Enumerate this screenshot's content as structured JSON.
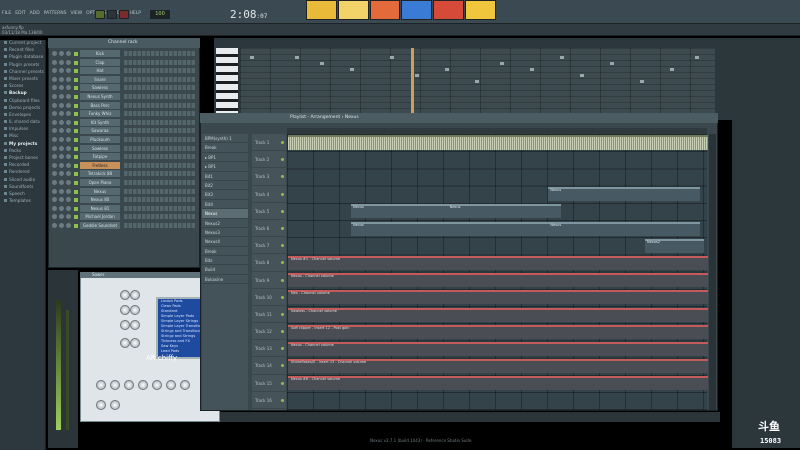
{
  "app": {
    "menu": [
      "FILE",
      "EDIT",
      "ADD",
      "PATTERNS",
      "VIEW",
      "OPTIONS",
      "TOOLS",
      "HELP"
    ],
    "time": "2:08",
    "time_suffix": ":07",
    "tempo": "100",
    "hint": "asfunny.flp",
    "hint2": "03/11/18 Ma 138/00",
    "thumb_colors": [
      "#e9b93a",
      "#f1d36a",
      "#e26a3b",
      "#3a7bd5",
      "#d64a3a",
      "#f0c63c"
    ]
  },
  "browser": {
    "items": [
      {
        "label": "Current project",
        "hl": false
      },
      {
        "label": "Recent files",
        "hl": false
      },
      {
        "label": "Plugin database",
        "hl": false
      },
      {
        "label": "Plugin presets",
        "hl": false
      },
      {
        "label": "Channel presets",
        "hl": false
      },
      {
        "label": "Mixer presets",
        "hl": false
      },
      {
        "label": "Scores",
        "hl": false
      },
      {
        "label": "Backup",
        "hl": true
      },
      {
        "label": "Clipboard files",
        "hl": false
      },
      {
        "label": "Demo projects",
        "hl": false
      },
      {
        "label": "Envelopes",
        "hl": false
      },
      {
        "label": "IL shared data",
        "hl": false
      },
      {
        "label": "Impulses",
        "hl": false
      },
      {
        "label": "Misc",
        "hl": false
      },
      {
        "label": "My projects",
        "hl": true
      },
      {
        "label": "Packs",
        "hl": false
      },
      {
        "label": "Project bones",
        "hl": false
      },
      {
        "label": "Recorded",
        "hl": false
      },
      {
        "label": "Rendered",
        "hl": false
      },
      {
        "label": "Sliced audio",
        "hl": false
      },
      {
        "label": "Soundfonts",
        "hl": false
      },
      {
        "label": "Speech",
        "hl": false
      },
      {
        "label": "Templates",
        "hl": false
      }
    ]
  },
  "rack": {
    "title": "Channel rack",
    "channels": [
      {
        "name": "Kick",
        "sel": false
      },
      {
        "name": "Clap",
        "sel": false
      },
      {
        "name": "Hat",
        "sel": false
      },
      {
        "name": "Snare",
        "sel": false
      },
      {
        "name": "Sawless",
        "sel": false
      },
      {
        "name": "Nexus Synth",
        "sel": false
      },
      {
        "name": "Bass Perc",
        "sel": false
      },
      {
        "name": "Funky Whiz",
        "sel": false
      },
      {
        "name": "Kit Synth",
        "sel": false
      },
      {
        "name": "Sawaraa",
        "sel": false
      },
      {
        "name": "Pluckuum",
        "sel": false
      },
      {
        "name": "Sawless",
        "sel": false
      },
      {
        "name": "Fatpipe",
        "sel": false
      },
      {
        "name": "Fretless",
        "sel": true
      },
      {
        "name": "Tetrakick 88",
        "sel": false
      },
      {
        "name": "Open Piano",
        "sel": false
      },
      {
        "name": "Nexus",
        "sel": false
      },
      {
        "name": "Nexus 80",
        "sel": false
      },
      {
        "name": "Nexus 81",
        "sel": false
      },
      {
        "name": "Michael Jordan",
        "sel": false
      },
      {
        "name": "Geddie Soundset",
        "sel": false
      }
    ]
  },
  "plugin": {
    "title": "Sawer",
    "preset_name": "AR chiffy",
    "presets": [
      "Lindon Pads",
      "Clean Pads",
      "Standard",
      "Simple Layer Pads",
      "Simple Layer Strings",
      "Simple Layer Transitions",
      "Strings and Transitions",
      "Stringz and Strings",
      "Tickness and FX",
      "Saw Keys",
      "Lead Pads"
    ]
  },
  "playlist": {
    "title": "Playlist - Arrangement › Nexus",
    "pick_items": [
      {
        "label": "BPM(synth) 1",
        "sel": false
      },
      {
        "label": "Break",
        "sel": false
      },
      {
        "label": "▸ BP1",
        "sel": false
      },
      {
        "label": "▸ BP1",
        "sel": false
      },
      {
        "label": "Bit1",
        "sel": false
      },
      {
        "label": "Bit2",
        "sel": false
      },
      {
        "label": "Bit3",
        "sel": false
      },
      {
        "label": "Bit4",
        "sel": false
      },
      {
        "label": "Nexus",
        "sel": true
      },
      {
        "label": "Nexus2",
        "sel": false
      },
      {
        "label": "Nexus3",
        "sel": false
      },
      {
        "label": "Nexus4",
        "sel": false
      },
      {
        "label": "Break",
        "sel": false
      },
      {
        "label": "Bits",
        "sel": false
      },
      {
        "label": "Build",
        "sel": false
      },
      {
        "label": "Bokasine",
        "sel": false
      }
    ],
    "tracks": [
      "Track 1",
      "Track 2",
      "Track 3",
      "Track 4",
      "Track 5",
      "Track 6",
      "Track 7",
      "Track 8",
      "Track 9",
      "Track 10",
      "Track 11",
      "Track 12",
      "Track 13",
      "Track 14",
      "Track 15",
      "Track 16"
    ],
    "clips": [
      {
        "label": "Nexus",
        "row": 3,
        "start": 0.62,
        "end": 0.98
      },
      {
        "label": "Nexus",
        "row": 4,
        "start": 0.15,
        "end": 0.38
      },
      {
        "label": "Nexus",
        "row": 4,
        "start": 0.38,
        "end": 0.65
      },
      {
        "label": "Nexus",
        "row": 5,
        "start": 0.15,
        "end": 0.62
      },
      {
        "label": "Nexus",
        "row": 5,
        "start": 0.62,
        "end": 0.98
      },
      {
        "label": "Nexus2",
        "row": 6,
        "start": 0.85,
        "end": 0.99
      }
    ],
    "automation": [
      {
        "label": "Nexus #1 - Channel volume",
        "row": 7
      },
      {
        "label": "Nexus - Channel volume",
        "row": 8
      },
      {
        "label": "Nex - Channel volume",
        "row": 9
      },
      {
        "label": "Sawless - Channel volume",
        "row": 10
      },
      {
        "label": "Soft clipper - Insert 12 - Post gain",
        "row": 11
      },
      {
        "label": "Nexus - Channel volume",
        "row": 12
      },
      {
        "label": "Stickeflakes/0 - Insert 13 - Channel volume",
        "row": 13
      },
      {
        "label": "Nexus #6 - Channel volume",
        "row": 14
      }
    ]
  },
  "status": {
    "hint": "Nexus v2.7.1 (build 1043) - Reference Studio Suite"
  },
  "watermark": {
    "logo": "斗鱼",
    "room_id": "15083"
  }
}
